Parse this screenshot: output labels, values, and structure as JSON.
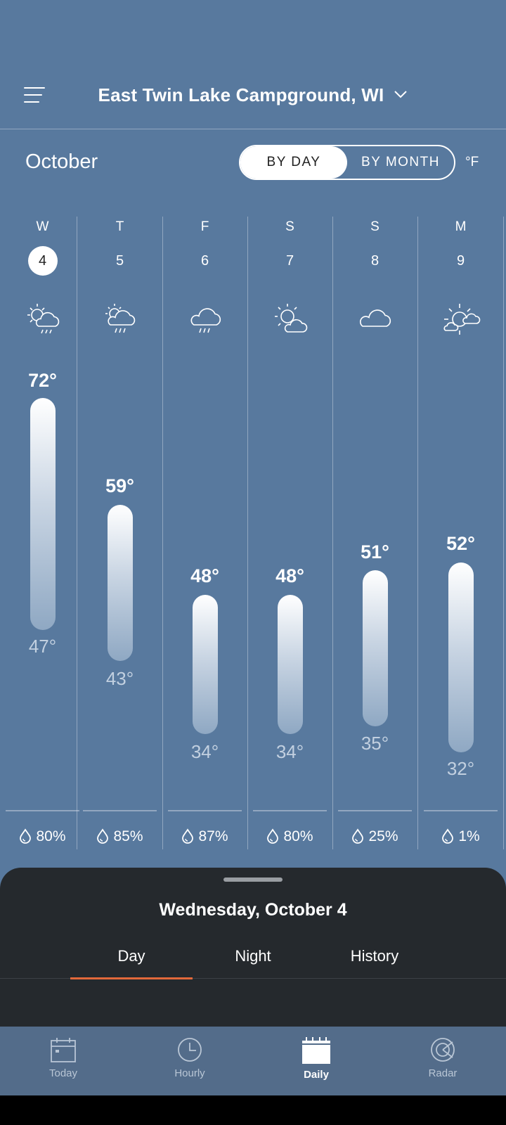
{
  "header": {
    "location": "East Twin Lake Campground, WI"
  },
  "controls": {
    "month": "October",
    "toggle": [
      "BY DAY",
      "BY MONTH"
    ],
    "active_toggle": "BY DAY",
    "unit": "°F"
  },
  "days": [
    {
      "dow": "W",
      "date": "4",
      "high": "72°",
      "low": "47°",
      "precip": "80%",
      "icon": "sun-cloud-rain-icon",
      "selected": true
    },
    {
      "dow": "T",
      "date": "5",
      "high": "59°",
      "low": "43°",
      "precip": "85%",
      "icon": "sun-cloud-rain-icon"
    },
    {
      "dow": "F",
      "date": "6",
      "high": "48°",
      "low": "34°",
      "precip": "87%",
      "icon": "cloud-rain-icon"
    },
    {
      "dow": "S",
      "date": "7",
      "high": "48°",
      "low": "34°",
      "precip": "80%",
      "icon": "partly-cloudy-icon"
    },
    {
      "dow": "S",
      "date": "8",
      "high": "51°",
      "low": "35°",
      "precip": "25%",
      "icon": "cloud-icon"
    },
    {
      "dow": "M",
      "date": "9",
      "high": "52°",
      "low": "32°",
      "precip": "1%",
      "icon": "mostly-sunny-icon"
    }
  ],
  "detail": {
    "title": "Wednesday, October 4",
    "tabs": [
      "Day",
      "Night",
      "History"
    ],
    "active_tab": "Day"
  },
  "nav": [
    {
      "label": "Today",
      "icon": "calendar-icon"
    },
    {
      "label": "Hourly",
      "icon": "clock-icon"
    },
    {
      "label": "Daily",
      "icon": "daily-calendar-icon",
      "active": true
    },
    {
      "label": "Radar",
      "icon": "radar-icon"
    }
  ],
  "colors": {
    "background": "#58799e",
    "sheet": "#25292d",
    "accent": "#e2683a",
    "navbar": "#536c8a"
  }
}
